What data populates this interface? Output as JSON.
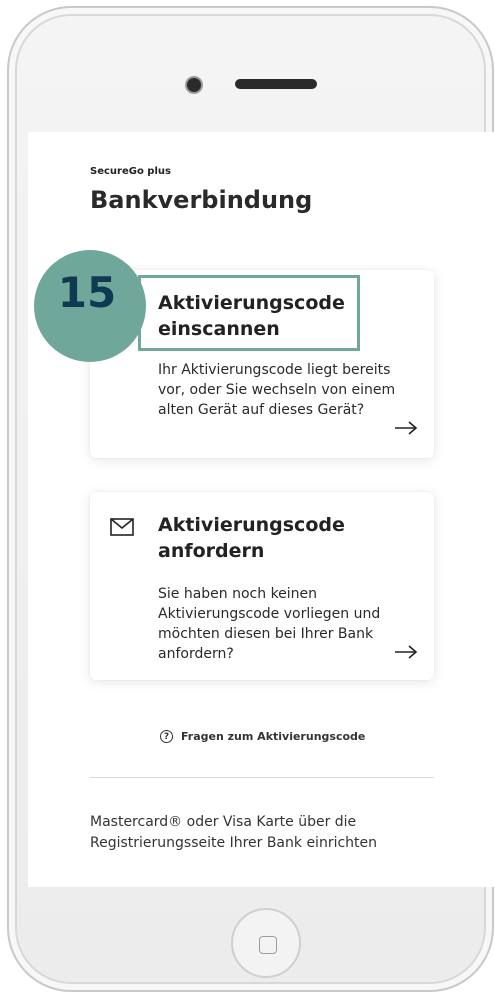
{
  "app": {
    "name": "SecureGo plus",
    "title": "Bankverbindung"
  },
  "cards": [
    {
      "title": "Aktivierungscode einscannen",
      "description": "Ihr Aktivierungscode liegt bereits vor, oder Sie wechseln von einem alten Gerät auf dieses Gerät?",
      "icon": "none",
      "arrow": "arrow-right-icon"
    },
    {
      "title": "Aktivierungscode anfordern",
      "description": "Sie haben noch keinen Aktivierungscode vorliegen und möchten diesen bei Ihrer Bank anfordern?",
      "icon": "mail-icon",
      "arrow": "arrow-right-icon"
    }
  ],
  "help": {
    "label": "Fragen zum Aktivierungscode",
    "icon": "question-circle-icon"
  },
  "footer": {
    "text": "Mastercard® oder Visa Karte über die Registrierungsseite Ihrer Bank einrichten"
  },
  "callout": {
    "number": "15"
  },
  "colors": {
    "accent": "#6fa89a",
    "callout_text": "#0f3a52"
  }
}
